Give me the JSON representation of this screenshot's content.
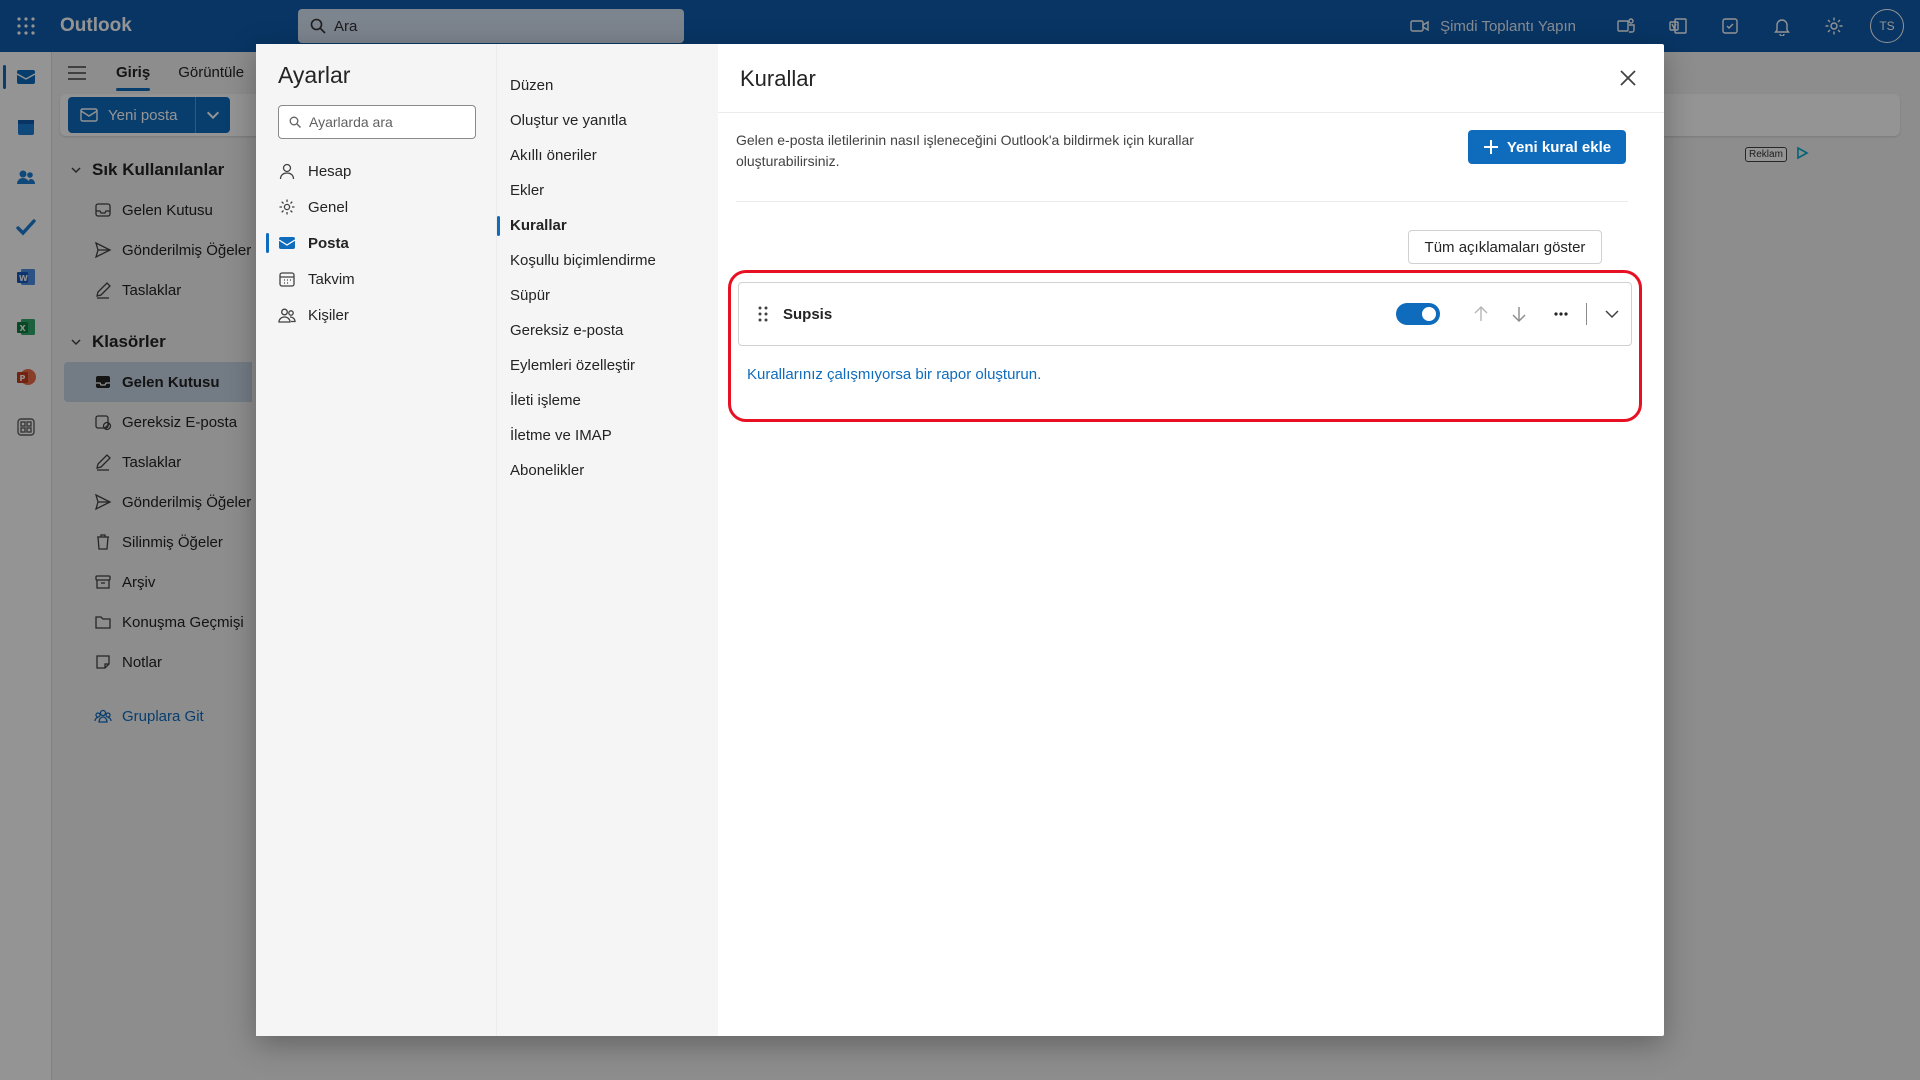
{
  "app": {
    "name": "Outlook",
    "search_placeholder": "Ara"
  },
  "topbar": {
    "meet_now": "Şimdi Toplantı Yapın",
    "avatar_initials": "TS"
  },
  "ribbon": {
    "tabs": [
      "Giriş",
      "Görüntüle"
    ],
    "new_mail": "Yeni posta",
    "ad_label": "Reklam"
  },
  "folders": {
    "favorites_title": "Sık Kullanılanlar",
    "favorites": [
      "Gelen Kutusu",
      "Gönderilmiş Öğeler",
      "Taslaklar"
    ],
    "folders_title": "Klasörler",
    "folders": [
      "Gelen Kutusu",
      "Gereksiz E-posta",
      "Taslaklar",
      "Gönderilmiş Öğeler",
      "Silinmiş Öğeler",
      "Arşiv",
      "Konuşma Geçmişi",
      "Notlar"
    ],
    "groups_link": "Gruplara Git"
  },
  "settings": {
    "title": "Ayarlar",
    "search_placeholder": "Ayarlarda ara",
    "categories": [
      "Hesap",
      "Genel",
      "Posta",
      "Takvim",
      "Kişiler"
    ],
    "subcategories": [
      "Düzen",
      "Oluştur ve yanıtla",
      "Akıllı öneriler",
      "Ekler",
      "Kurallar",
      "Koşullu biçimlendirme",
      "Süpür",
      "Gereksiz e-posta",
      "Eylemleri özelleştir",
      "İleti işleme",
      "İletme ve IMAP",
      "Abonelikler"
    ]
  },
  "rules": {
    "title": "Kurallar",
    "description": "Gelen e-posta iletilerinin nasıl işleneceğini Outlook'a bildirmek için kurallar oluşturabilirsiniz.",
    "new_rule": "Yeni kural ekle",
    "show_all": "Tüm açıklamaları göster",
    "items": [
      {
        "name": "Supsis",
        "enabled": true
      }
    ],
    "report_link": "Kurallarınız çalışmıyorsa bir rapor oluşturun."
  },
  "colors": {
    "brand": "#0f5cad",
    "accent": "#0f6cbd",
    "highlight": "#e81123"
  }
}
